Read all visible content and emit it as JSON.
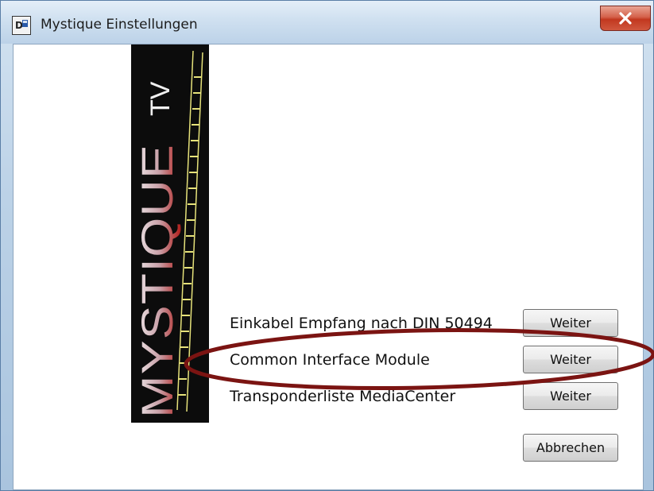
{
  "window": {
    "title": "Mystique Einstellungen"
  },
  "logo": {
    "brand": "MYSTIQUE",
    "suffix": "TV"
  },
  "options": [
    {
      "label": "Einkabel Empfang nach DIN 50494",
      "button": "Weiter"
    },
    {
      "label": "Common Interface Module",
      "button": "Weiter"
    },
    {
      "label": "Transponderliste MediaCenter",
      "button": "Weiter"
    }
  ],
  "cancel_button": "Abbrechen",
  "annotation": {
    "color": "#7b1412",
    "target": "Common Interface Module"
  },
  "colors": {
    "close_button": "#c2381f",
    "logo_bg": "#0c0c0c",
    "film_strip": "#e6e27a"
  }
}
